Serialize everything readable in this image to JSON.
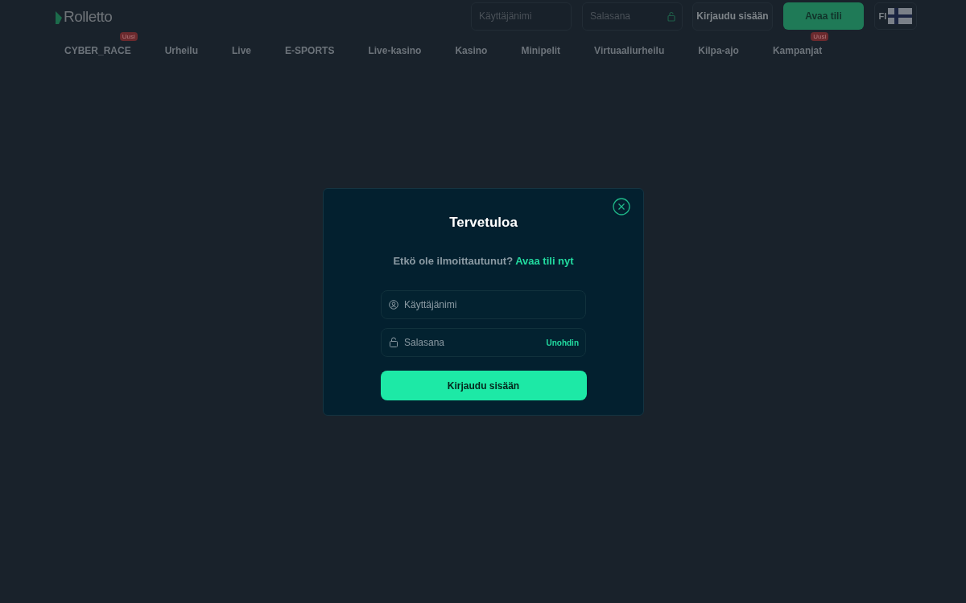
{
  "header": {
    "logo": "Rolletto",
    "username_field": {
      "placeholder": "Käyttäjänimi"
    },
    "password_field": {
      "placeholder": "Salasana"
    },
    "login_button": "Kirjaudu sisään",
    "register_button": "Avaa tili",
    "language": "FI"
  },
  "nav": [
    {
      "label": "CYBER_RACE",
      "badge": "Uusi"
    },
    {
      "label": "Urheilu"
    },
    {
      "label": "Live"
    },
    {
      "label": "E-SPORTS"
    },
    {
      "label": "Live-kasino"
    },
    {
      "label": "Kasino"
    },
    {
      "label": "Minipelit"
    },
    {
      "label": "Virtuaaliurheilu"
    },
    {
      "label": "Kilpa-ajo"
    },
    {
      "label": "Kampanjat",
      "badge": "Uusi"
    }
  ],
  "modal": {
    "title": "Tervetuloa",
    "prompt": "Etkö ole ilmoittautunut?",
    "prompt_link": "Avaa tili nyt",
    "username_field": {
      "placeholder": "Käyttäjänimi"
    },
    "password_field": {
      "placeholder": "Salasana",
      "forgot_link": "Unohdin"
    },
    "submit_button": "Kirjaudu sisään"
  }
}
